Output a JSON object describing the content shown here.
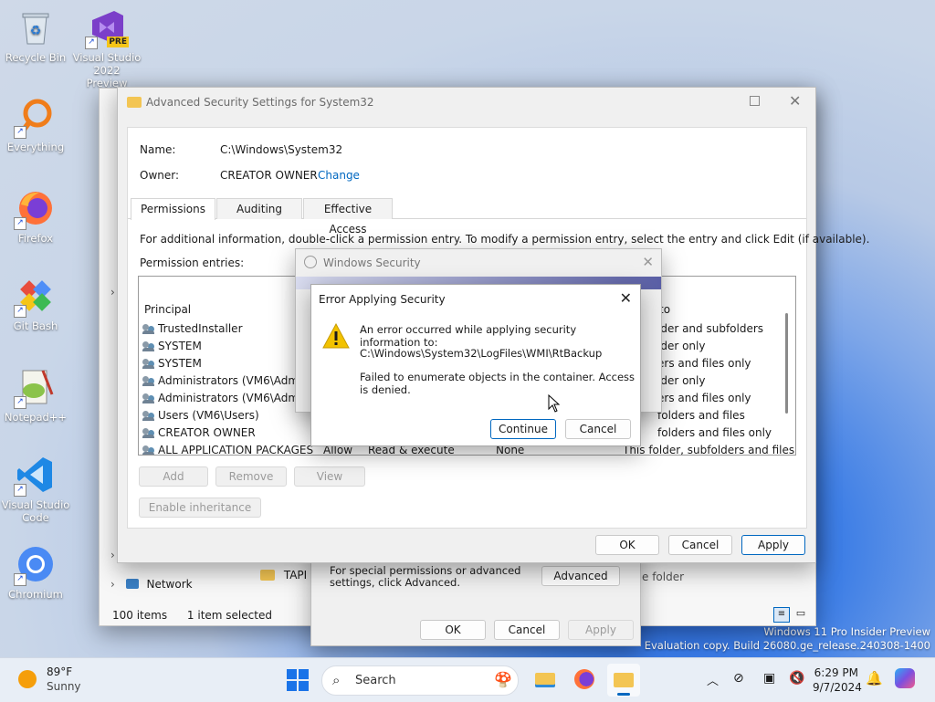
{
  "desktop": {
    "icons": [
      {
        "label": "Recycle Bin"
      },
      {
        "label": "Visual Studio 2022 Preview",
        "badge": "PRE"
      },
      {
        "label": "Everything"
      },
      {
        "label": "Firefox"
      },
      {
        "label": "Git Bash"
      },
      {
        "label": "Notepad++"
      },
      {
        "label": "Visual Studio Code"
      },
      {
        "label": "Chromium"
      }
    ],
    "watermark": {
      "line1": "Windows 11 Pro Insider Preview",
      "line2": "Evaluation copy. Build 26080.ge_release.240308-1400"
    }
  },
  "explorer": {
    "nav_network": "Network",
    "folder_item": "TAPI",
    "folder_item_type": "e folder",
    "status_items": "100 items",
    "status_selected": "1 item selected"
  },
  "properties": {
    "advanced_text": "For special permissions or advanced settings, click Advanced.",
    "advanced_button": "Advanced",
    "ok": "OK",
    "cancel": "Cancel",
    "apply": "Apply"
  },
  "advanced": {
    "title": "Advanced Security Settings for System32",
    "name_label": "Name:",
    "name_value": "C:\\Windows\\System32",
    "owner_label": "Owner:",
    "owner_value": "CREATOR OWNER",
    "owner_change": "Change",
    "tabs": [
      "Permissions",
      "Auditing",
      "Effective Access"
    ],
    "info": "For additional information, double-click a permission entry. To modify a permission entry, select the entry and click Edit (if available).",
    "entries_label": "Permission entries:",
    "col_principal": "Principal",
    "col_applies": "to",
    "rows": [
      {
        "principal": "TrustedInstaller",
        "applies": "lder and subfolders"
      },
      {
        "principal": "SYSTEM",
        "applies": "lder only"
      },
      {
        "principal": "SYSTEM",
        "applies": "ers and files only"
      },
      {
        "principal": "Administrators (VM6\\Admin",
        "applies": "lder only"
      },
      {
        "principal": "Administrators (VM6\\Admin",
        "applies": "ers and files only"
      },
      {
        "principal": "Users (VM6\\Users)",
        "applies": "folders and files"
      },
      {
        "principal": "CREATOR OWNER",
        "applies": "folders and files only"
      },
      {
        "principal": "ALL APPLICATION PACKAGES",
        "type": "Allow",
        "access": "Read & execute",
        "inherited": "None",
        "applies": "This folder, subfolders and files"
      }
    ],
    "add": "Add",
    "remove": "Remove",
    "view": "View",
    "enable_inheritance": "Enable inheritance",
    "ok": "OK",
    "cancel": "Cancel",
    "apply": "Apply"
  },
  "winsec": {
    "title": "Windows Security"
  },
  "error": {
    "title": "Error Applying Security",
    "line1": "An error occurred while applying security information to:",
    "path": "C:\\Windows\\System32\\LogFiles\\WMI\\RtBackup",
    "line3": "Failed to enumerate objects in the container. Access is denied.",
    "continue": "Continue",
    "cancel": "Cancel"
  },
  "taskbar": {
    "weather_temp": "89°F",
    "weather_desc": "Sunny",
    "search_placeholder": "Search",
    "time": "6:29 PM",
    "date": "9/7/2024"
  },
  "colors": {
    "accent": "#0067c0",
    "link": "#0067c0",
    "warning": "#f2c200"
  }
}
